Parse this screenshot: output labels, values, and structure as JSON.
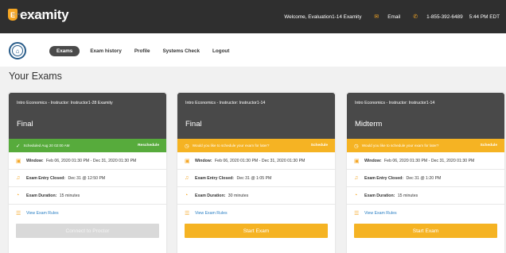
{
  "header": {
    "logo_mark": "E",
    "logo_text": "examity",
    "logo_tagline": "BETTER TEST INTEGRITY",
    "welcome": "Welcome, Evaluation1-14 Examity",
    "email_label": "Email",
    "phone": "1-855-392-6489",
    "time": "5:44 PM EDT",
    "accent_color": "#f5a623"
  },
  "nav": {
    "items": [
      {
        "label": "Exams",
        "active": true
      },
      {
        "label": "Exam history",
        "active": false
      },
      {
        "label": "Profile",
        "active": false
      },
      {
        "label": "Systems Check",
        "active": false
      },
      {
        "label": "Logout",
        "active": false
      }
    ]
  },
  "page_title": "Your Exams",
  "cards": [
    {
      "course": "Intro Economics - Instructor: Instructor1-28 Examity",
      "exam_type": "Final",
      "banner": {
        "text": "Scheduled Aug 20 02:00 AM",
        "action": "Reschedule",
        "status": "green"
      },
      "window_label": "Window:",
      "window_value": "Feb 06, 2020 01:30 PM - Dec 31, 2020 01:30 PM",
      "entry_label": "Exam Entry Closed:",
      "entry_value": "Dec 31 @ 12:50 PM",
      "duration_label": "Exam Duration:",
      "duration_value": "15 minutes",
      "rules_link": "View Exam Rules",
      "button_label": "Connect to Proctor",
      "button_state": "disabled"
    },
    {
      "course": "Intro Economics - Instructor: Instructor1-14",
      "exam_type": "Final",
      "banner": {
        "text": "Would you like to schedule your exam for later?",
        "action": "Schedule",
        "status": "yellow"
      },
      "window_label": "Window:",
      "window_value": "Feb 06, 2020 01:30 PM - Dec 31, 2020 01:30 PM",
      "entry_label": "Exam Entry Closed:",
      "entry_value": "Dec 31 @ 1:05 PM",
      "duration_label": "Exam Duration:",
      "duration_value": "30 minutes",
      "rules_link": "View Exam Rules",
      "button_label": "Start Exam",
      "button_state": "primary"
    },
    {
      "course": "Intro Economics - Instructor: Instructor1-14",
      "exam_type": "Midterm",
      "banner": {
        "text": "Would you like to schedule your exam for later?",
        "action": "Schedule",
        "status": "yellow"
      },
      "window_label": "Window:",
      "window_value": "Feb 06, 2020 01:30 PM - Dec 31, 2020 01:30 PM",
      "entry_label": "Exam Entry Closed:",
      "entry_value": "Dec 31 @ 1:20 PM",
      "duration_label": "Exam Duration:",
      "duration_value": "15 minutes",
      "rules_link": "View Exam Rules",
      "button_label": "Start Exam",
      "button_state": "primary"
    }
  ]
}
